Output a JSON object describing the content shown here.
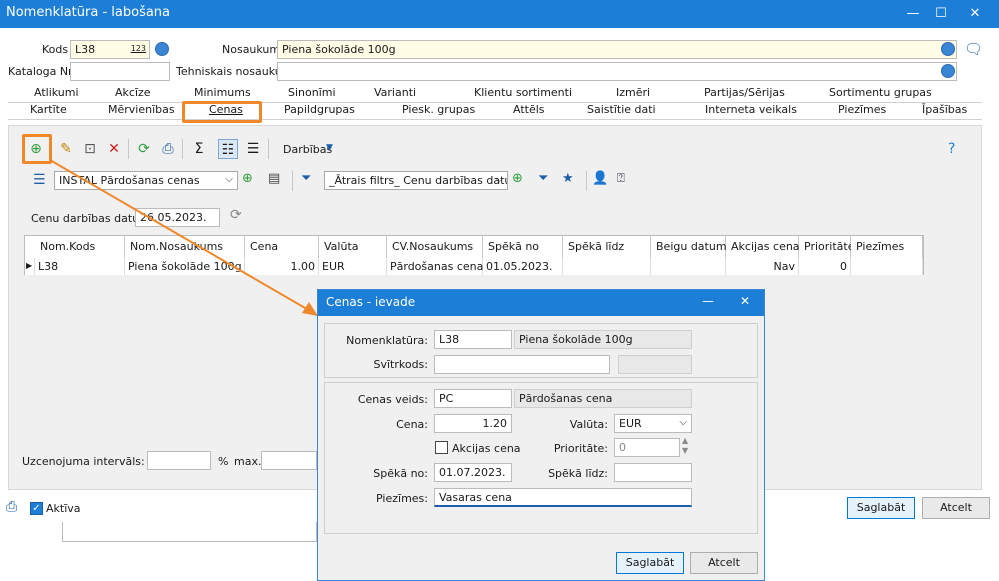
{
  "window": {
    "title": "Nomenklatūra - labošana",
    "min": "—",
    "max": "☐",
    "close": "✕"
  },
  "header": {
    "kods_label": "Kods",
    "kods_value": "L38",
    "kods_suffix": "123",
    "nosaukums_label": "Nosaukums",
    "nosaukums_value": "Piena šokolāde 100g",
    "kataloga_label": "Kataloga Nr.",
    "kataloga_value": "",
    "tehniskais_label": "Tehniskais nosaukums",
    "tehniskais_value": ""
  },
  "tabs_row1": [
    "Atlikumi",
    "Akcīze",
    "Minimums",
    "Sinonīmi",
    "Varianti",
    "Klientu sortimenti",
    "Izmēri",
    "Partijas/Sērijas",
    "Sortimentu grupas"
  ],
  "tabs_row2": [
    "Kartīte",
    "Mērvienības",
    "Cenas",
    "Papildgrupas",
    "Piesk. grupas",
    "Attēls",
    "Saistītie dati",
    "Interneta veikals",
    "Piezīmes",
    "Īpašības"
  ],
  "toolbar": {
    "actions_label": "Darbības",
    "help": "?"
  },
  "filter": {
    "view_value": "INSTAL Pārdošanas cenas",
    "quick_filter": "_Ātrais filtrs_ Cenu darbības datums"
  },
  "date_filter": {
    "label": "Cenu darbības datums",
    "value": "26.05.2023."
  },
  "grid": {
    "columns": [
      "Nom.Kods",
      "Nom.Nosaukums",
      "Cena",
      "Valūta",
      "CV.Nosaukums",
      "Spēkā no",
      "Spēkā līdz",
      "Beigu datum...",
      "Akcijas cena",
      "Prioritāte",
      "Piezīmes"
    ],
    "row": {
      "kods": "L38",
      "nosaukums": "Piena šokolāde 100g",
      "cena": "1.00",
      "valuta": "EUR",
      "cv": "Pārdošanas cena",
      "speka_no": "01.05.2023.",
      "speka_lidz": "",
      "beigu": "",
      "akcijas": "Nav",
      "prioritate": "0",
      "piezimes": ""
    }
  },
  "margin": {
    "label": "Uzcenojuma intervāls: min.",
    "pct": "%",
    "max_label": "max."
  },
  "bottom": {
    "aktiva": "Aktīva",
    "save": "Saglabāt",
    "cancel": "Atcelt"
  },
  "dialog": {
    "title": "Cenas - ievade",
    "min": "—",
    "close": "✕",
    "nom_label": "Nomenklatūra:",
    "nom_code": "L38",
    "nom_name": "Piena šokolāde 100g",
    "barcode_label": "Svītrkods:",
    "type_label": "Cenas veids:",
    "type_code": "PC",
    "type_name": "Pārdošanas cena",
    "price_label": "Cena:",
    "price_value": "1.20",
    "currency_label": "Valūta:",
    "currency_value": "EUR",
    "akcijas_label": "Akcijas cena",
    "prio_label": "Prioritāte:",
    "prio_value": "0",
    "from_label": "Spēkā no:",
    "from_value": "01.07.2023.",
    "to_label": "Spēkā līdz:",
    "to_value": "",
    "notes_label": "Piezīmes:",
    "notes_value": "Vasaras cena",
    "save": "Saglabāt",
    "cancel": "Atcelt"
  },
  "colors": {
    "titlebar": "#1c7ed6",
    "highlight": "#f0882a",
    "input_yellow": "#fffde6"
  }
}
